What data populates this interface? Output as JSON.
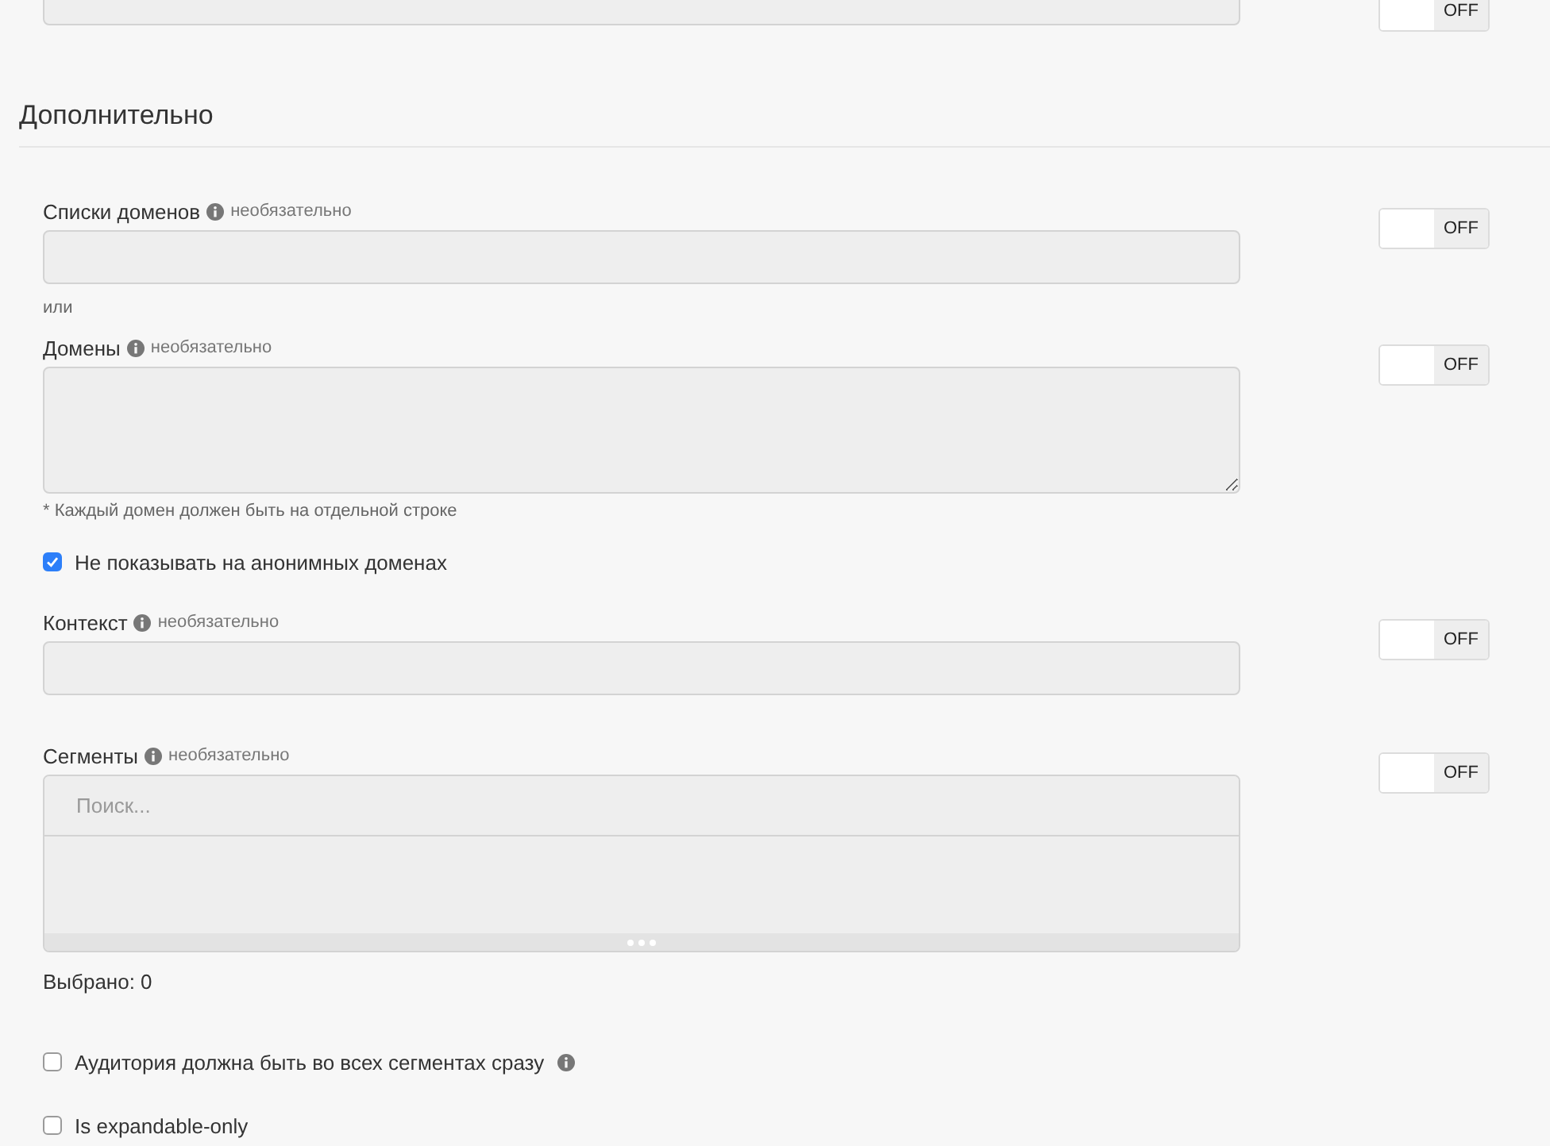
{
  "top_row": {
    "toggle": {
      "label": "OFF",
      "on": false
    }
  },
  "section": {
    "title": "Дополнительно"
  },
  "items": [
    {
      "kind": "input",
      "label": "Списки доменов",
      "hint": "необязательно",
      "toggle": {
        "label": "OFF",
        "on": false
      }
    },
    {
      "kind": "separator",
      "text": "или"
    },
    {
      "kind": "textarea",
      "label": "Домены",
      "hint": "необязательно",
      "toggle": {
        "label": "OFF",
        "on": false
      },
      "note": "* Каждый домен должен быть на отдельной строке"
    },
    {
      "kind": "checkbox",
      "label": "Не показывать на анонимных доменах",
      "checked": true
    },
    {
      "kind": "input",
      "label": "Контекст",
      "hint": "необязательно",
      "toggle": {
        "label": "OFF",
        "on": false
      }
    },
    {
      "kind": "segments",
      "label": "Сегменты",
      "hint": "необязательно",
      "placeholder": "Поиск...",
      "toggle": {
        "label": "OFF",
        "on": false
      },
      "selected_count": "Выбрано: 0"
    },
    {
      "kind": "checkbox",
      "label": "Аудитория должна быть во всех сегментах сразу",
      "checked": false,
      "info": true
    },
    {
      "kind": "checkbox",
      "label": "Is expandable-only",
      "checked": false
    }
  ]
}
